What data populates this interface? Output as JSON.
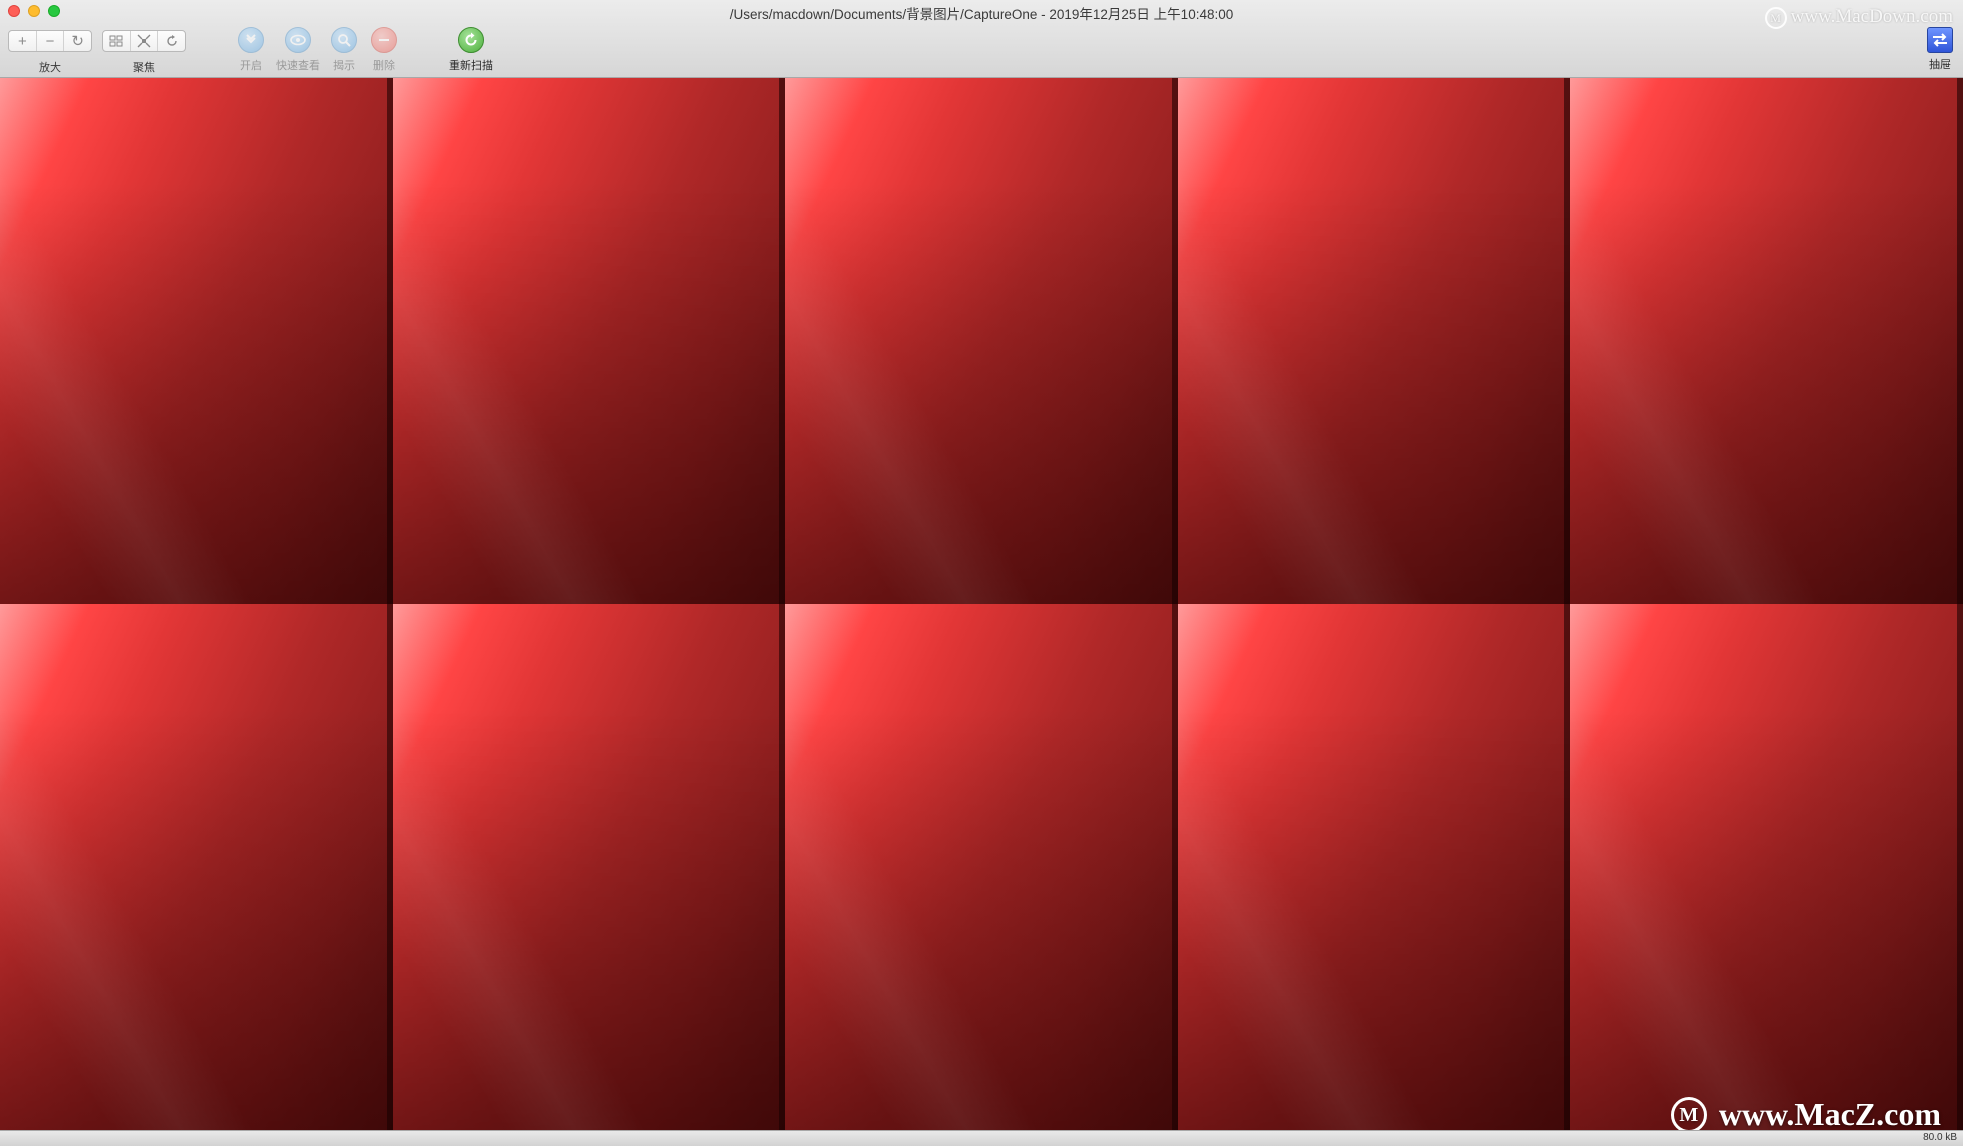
{
  "window": {
    "title": "/Users/macdown/Documents/背景图片/CaptureOne - 2019年12月25日 上午10:48:00"
  },
  "watermarks": {
    "top": "www.MacDown.com",
    "bottom": "www.MacZ.com"
  },
  "toolbar": {
    "zoom": {
      "label": "放大",
      "zoom_in": "+",
      "zoom_out": "−",
      "reset": "↻"
    },
    "focus": {
      "label": "聚焦",
      "icons": [
        "grid-icon",
        "fit-icon",
        "rotate-icon"
      ]
    },
    "open_label": "开启",
    "quicklook_label": "快速查看",
    "reveal_label": "揭示",
    "delete_label": "删除",
    "rescan_label": "重新扫描",
    "drawer_label": "抽屉"
  },
  "grid": {
    "columns": 5,
    "rows": 2,
    "thumbnail_count": 10
  },
  "status": {
    "size": "80.0 kB"
  },
  "colors": {
    "thumbnail_accent": "#e23636",
    "rescan": "#4caf3c",
    "drawer": "#2f55d8"
  }
}
